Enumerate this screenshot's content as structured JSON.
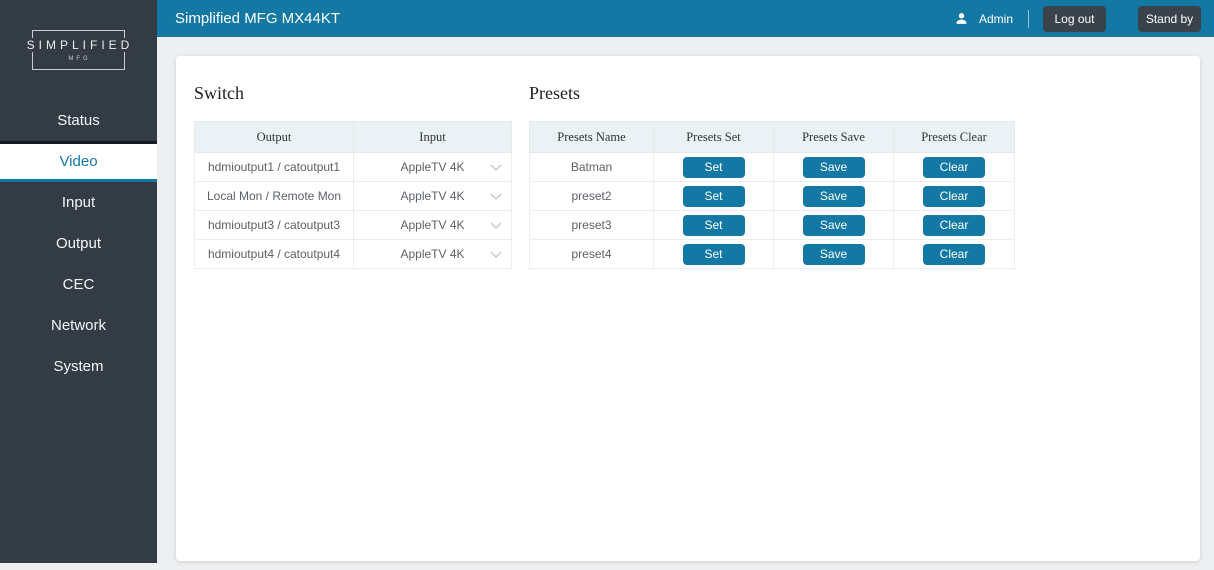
{
  "topbar": {
    "title": "Simplified MFG MX44KT",
    "user_label": "Admin",
    "logout_label": "Log out",
    "standby_label": "Stand by"
  },
  "sidebar": {
    "logo_line1": "SIMPLIFIED",
    "logo_line2": "MFG",
    "items": [
      {
        "label": "Status",
        "active": false
      },
      {
        "label": "Video",
        "active": true
      },
      {
        "label": "Input",
        "active": false
      },
      {
        "label": "Output",
        "active": false
      },
      {
        "label": "CEC",
        "active": false
      },
      {
        "label": "Network",
        "active": false
      },
      {
        "label": "System",
        "active": false
      }
    ]
  },
  "switch_section": {
    "title": "Switch",
    "columns": [
      "Output",
      "Input"
    ],
    "rows": [
      {
        "output": "hdmioutput1 / catoutput1",
        "input": "AppleTV 4K"
      },
      {
        "output": "Local Mon / Remote Mon",
        "input": "AppleTV 4K"
      },
      {
        "output": "hdmioutput3 / catoutput3",
        "input": "AppleTV 4K"
      },
      {
        "output": "hdmioutput4 / catoutput4",
        "input": "AppleTV 4K"
      }
    ]
  },
  "presets_section": {
    "title": "Presets",
    "columns": [
      "Presets Name",
      "Presets Set",
      "Presets Save",
      "Presets Clear"
    ],
    "set_label": "Set",
    "save_label": "Save",
    "clear_label": "Clear",
    "rows": [
      {
        "name": "Batman"
      },
      {
        "name": "preset2"
      },
      {
        "name": "preset3"
      },
      {
        "name": "preset4"
      }
    ]
  },
  "colors": {
    "accent": "#1478a5",
    "sidebar_bg": "#333b44",
    "dark_button_bg": "#3a424b",
    "table_header_bg": "#eaf2f5",
    "page_bg": "#edeff1"
  }
}
